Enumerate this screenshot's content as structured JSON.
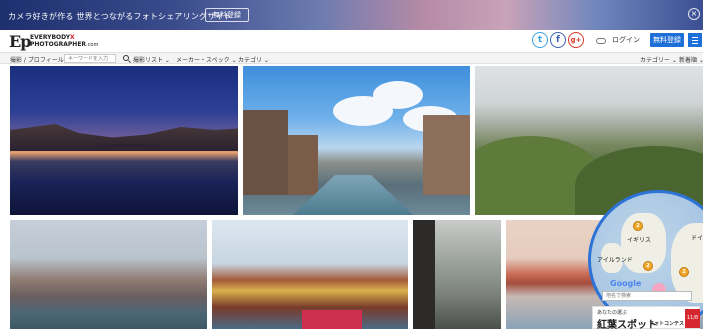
{
  "promo": {
    "text": "カメラ好きが作る 世界とつながるフォトシェアリングサイト",
    "button": "無料登録"
  },
  "header": {
    "logo_mark": "Ep",
    "logo_line1": "EVERYBODY",
    "logo_x": "X",
    "logo_line2": "PHOTOGRAPHER",
    "logo_com": ".com",
    "twitter": "t",
    "facebook": "f",
    "gplus": "g+",
    "login": "ログイン",
    "register": "無料登録"
  },
  "filters": {
    "dropdown1": "撮影 / プロフィール名 ⌄",
    "keyword_placeholder": "キーワードを入力",
    "popular": "撮影リスト ⌄",
    "maker": "メーカー・スペック ⌄",
    "category": "カテゴリ ⌄",
    "right1": "カテゴリー ⌄",
    "right2": "新着順 ⌄"
  },
  "map": {
    "label_uk": "イギリス",
    "label_ireland": "アイルランド",
    "label_germany": "ドイツ",
    "pin1": "2",
    "pin2": "2",
    "pin3": "2",
    "google": "Google",
    "search_placeholder": "地名で検索"
  },
  "ad": {
    "small": "あなたの選ぶ",
    "big": "紅葉スポット",
    "sub": "フォトコンテスト",
    "badge": "11/8"
  },
  "colors": {
    "accent": "#1e6fd8",
    "map_border": "#2d73d6",
    "ad_badge": "#d6262f"
  }
}
